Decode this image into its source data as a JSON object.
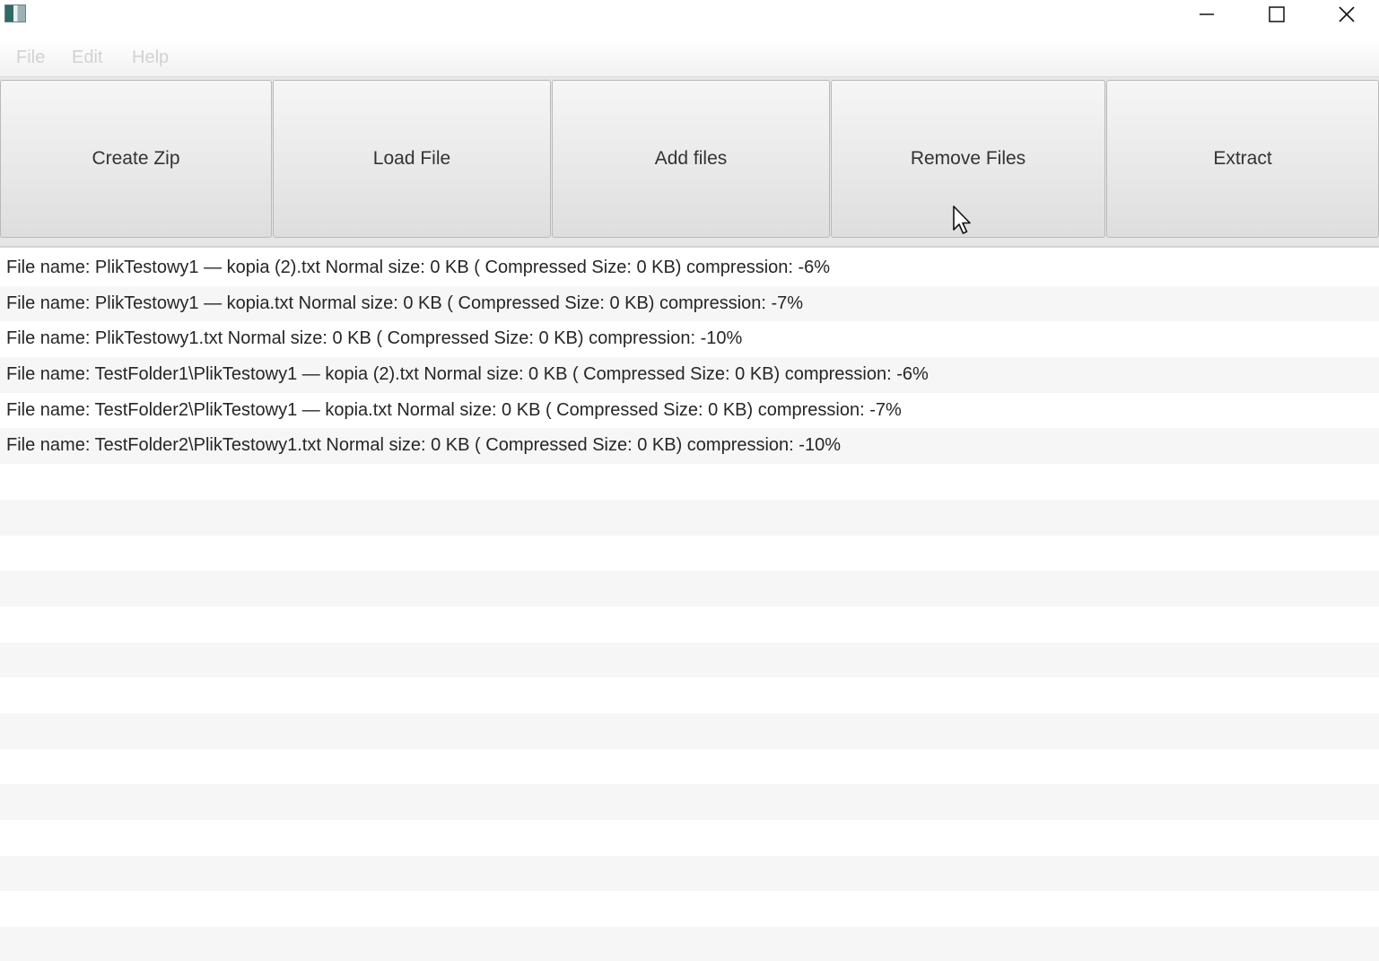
{
  "window": {
    "icon": "app-window-icon",
    "controls": {
      "minimize_icon": "minimize-icon",
      "maximize_icon": "maximize-icon",
      "close_icon": "close-icon"
    }
  },
  "menubar": {
    "items": [
      {
        "label": "File"
      },
      {
        "label": "Edit"
      },
      {
        "label": "Help"
      }
    ]
  },
  "toolbar": {
    "buttons": [
      {
        "label": "Create Zip"
      },
      {
        "label": "Load File"
      },
      {
        "label": "Add files"
      },
      {
        "label": "Remove Files"
      },
      {
        "label": "Extract"
      }
    ]
  },
  "files": [
    "File name: PlikTestowy1 — kopia (2).txt Normal size: 0 KB ( Compressed Size: 0 KB) compression: -6%",
    "File name: PlikTestowy1 — kopia.txt Normal size: 0 KB ( Compressed Size: 0 KB) compression: -7%",
    "File name: PlikTestowy1.txt Normal size: 0 KB ( Compressed Size: 0 KB) compression: -10%",
    "File name: TestFolder1\\PlikTestowy1 — kopia (2).txt Normal size: 0 KB ( Compressed Size: 0 KB) compression: -6%",
    "File name: TestFolder2\\PlikTestowy1 — kopia.txt Normal size: 0 KB ( Compressed Size: 0 KB) compression: -7%",
    "File name: TestFolder2\\PlikTestowy1.txt Normal size: 0 KB ( Compressed Size: 0 KB) compression: -10%"
  ],
  "colors": {
    "menu_disabled": "#d2d2d2",
    "row_alt": "#f6f6f6",
    "toolbar_bg": "#e6e6e6"
  }
}
